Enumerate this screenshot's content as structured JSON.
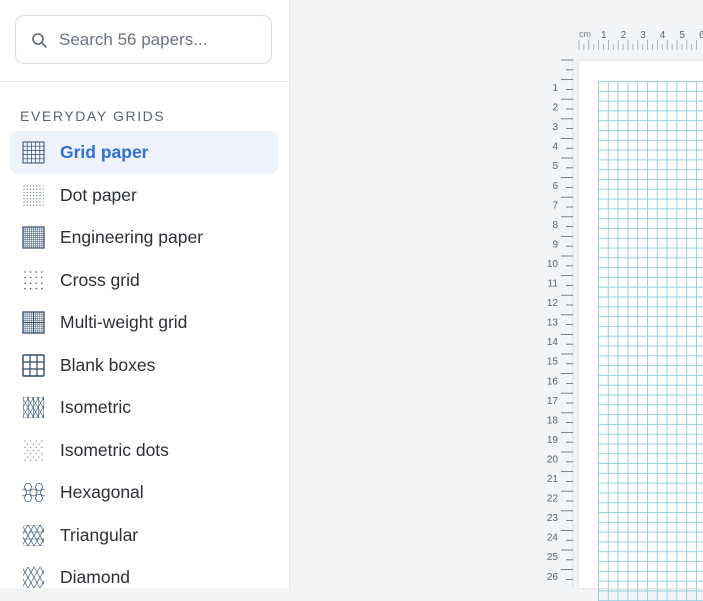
{
  "search": {
    "placeholder": "Search 56 papers..."
  },
  "section": {
    "title": "EVERYDAY GRIDS"
  },
  "items": [
    {
      "label": "Grid paper",
      "icon": "grid-icon",
      "active": true
    },
    {
      "label": "Dot paper",
      "icon": "dot-grid-icon",
      "active": false
    },
    {
      "label": "Engineering paper",
      "icon": "engineering-grid-icon",
      "active": false
    },
    {
      "label": "Cross grid",
      "icon": "cross-grid-icon",
      "active": false
    },
    {
      "label": "Multi-weight grid",
      "icon": "multi-weight-grid-icon",
      "active": false
    },
    {
      "label": "Blank boxes",
      "icon": "blank-boxes-icon",
      "active": false
    },
    {
      "label": "Isometric",
      "icon": "isometric-icon",
      "active": false
    },
    {
      "label": "Isometric dots",
      "icon": "isometric-dots-icon",
      "active": false
    },
    {
      "label": "Hexagonal",
      "icon": "hexagonal-icon",
      "active": false
    },
    {
      "label": "Triangular",
      "icon": "triangular-icon",
      "active": false
    },
    {
      "label": "Diamond",
      "icon": "diamond-icon",
      "active": false
    }
  ],
  "ruler": {
    "unit": "cm",
    "top_labels": [
      "1",
      "2",
      "3",
      "4",
      "5",
      "6"
    ],
    "left_labels": [
      "1",
      "2",
      "3",
      "4",
      "5",
      "6",
      "7",
      "8",
      "9",
      "10",
      "11",
      "12",
      "13",
      "14",
      "15",
      "16",
      "17",
      "18",
      "19",
      "20",
      "21",
      "22",
      "23",
      "24",
      "25",
      "26"
    ]
  },
  "colors": {
    "accent": "#2f6fd6",
    "active_bg": "#eef3fb",
    "grid_line": "#8ec9df",
    "icon": "#2f4a6b"
  }
}
